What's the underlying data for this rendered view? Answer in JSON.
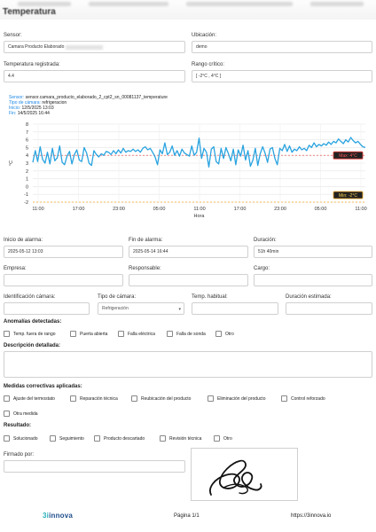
{
  "header": {
    "title": "Temperatura"
  },
  "fields": {
    "sensor": {
      "label": "Sensor:",
      "value": "Camara Producto Elaborado"
    },
    "ubicacion": {
      "label": "Ubicación:",
      "value": "demo"
    },
    "temp_registrada": {
      "label": "Temperatura registrada:",
      "value": "4.4"
    },
    "rango": {
      "label": "Rango crítico:",
      "value": "[ -2°C , 4°C ]"
    }
  },
  "chart_info": {
    "sensor_key": "Sensor:",
    "sensor_val": "sensor.camara_producto_elaborado_2_cpt2_sn_00081137_temperature",
    "tipo_key": "Tipo de cámara:",
    "tipo_val": "refrigeracion",
    "inicio_key": "Inicio:",
    "inicio_val": "12/5/2025 13:03",
    "fin_key": "Fin:",
    "fin_val": "14/5/2025 16:44"
  },
  "chart_data": {
    "type": "line",
    "ylabel": "°C",
    "xlabel": "Hora",
    "ylim": [
      -2,
      8
    ],
    "yticks": [
      -2,
      -1,
      0,
      1,
      2,
      3,
      4,
      5,
      6,
      7,
      8
    ],
    "xticks": [
      "11:00",
      "17:00",
      "23:00",
      "05:00",
      "11:00",
      "17:00",
      "23:00",
      "05:00",
      "11:00"
    ],
    "series": [
      {
        "values": [
          3.1,
          4.6,
          3.2,
          5.1,
          3.5,
          3.0,
          4.4,
          2.9,
          4.9,
          3.3,
          3.7,
          5.2,
          3.1,
          2.8,
          3.9,
          4.5,
          2.9,
          4.1,
          4.7,
          3.4,
          3.2,
          5.0,
          4.3,
          3.0,
          2.7,
          4.6,
          4.1,
          3.8,
          4.2,
          4.0,
          4.5,
          4.4,
          4.1,
          4.6,
          4.2,
          4.7,
          4.3,
          4.9,
          4.4,
          4.6,
          4.5,
          4.8,
          4.5,
          4.7,
          4.4,
          4.9,
          5.1,
          4.7,
          4.9,
          4.4,
          3.8,
          2.8,
          4.7,
          4.2,
          5.6,
          4.1,
          4.4,
          5.2,
          4.0,
          4.6,
          3.9,
          4.8,
          4.3,
          4.1,
          3.9,
          5.2,
          4.0,
          4.4,
          6.2,
          3.6,
          4.9,
          4.4,
          2.5,
          4.8,
          5.1,
          3.2,
          2.9,
          4.9,
          3.6,
          5.0,
          4.2,
          3.3,
          4.8,
          2.8,
          4.7,
          3.9,
          5.3,
          3.4,
          4.6,
          2.6,
          3.4,
          4.9,
          2.7,
          4.2,
          5.1,
          4.3,
          3.1,
          4.8,
          5.0,
          3.6,
          2.8,
          4.9,
          4.6,
          5.4,
          4.5,
          5.2,
          4.4,
          4.8,
          4.6,
          5.1,
          4.7,
          4.9,
          4.6,
          5.3,
          5.0,
          5.6,
          5.1,
          5.4,
          5.2,
          5.5,
          5.3,
          5.7,
          5.4,
          5.8,
          5.6,
          6.1,
          5.8,
          5.5,
          6.0,
          5.7,
          6.3,
          5.9,
          5.6,
          5.8,
          5.4,
          5.1,
          5.0
        ]
      }
    ],
    "threshold_lines": [
      {
        "label": "Max: 4°C",
        "value": 4,
        "color": "#e53935"
      },
      {
        "label": "Min: -2°C",
        "value": -2,
        "color": "#f9a825"
      }
    ]
  },
  "alarm": {
    "inicio": {
      "label": "Inicio de alarma:",
      "value": "2025-05-12 13:03"
    },
    "fin": {
      "label": "Fin de alarma:",
      "value": "2025-05-14 16:44"
    },
    "duracion": {
      "label": "Duración:",
      "value": "51h 40min"
    }
  },
  "people": {
    "empresa": {
      "label": "Empresa:"
    },
    "responsable": {
      "label": "Responsable:"
    },
    "cargo": {
      "label": "Cargo:"
    }
  },
  "camera": {
    "id": {
      "label": "Identificación cámara:"
    },
    "tipo": {
      "label": "Tipo de cámara:",
      "value": "Refrigeración"
    },
    "temp_habitual": {
      "label": "Temp. habitual:"
    },
    "duracion_est": {
      "label": "Duración estimada:"
    }
  },
  "anomalias": {
    "title": "Anomalías detectadas:",
    "options": [
      "Temp. fuera de rango",
      "Puerta abierta",
      "Falla eléctrica",
      "Falla de sonda",
      "Otro"
    ]
  },
  "descripcion": {
    "title": "Descripción detallada:"
  },
  "medidas": {
    "title": "Medidas correctivas aplicadas:",
    "options": [
      "Ajuste del termostato",
      "Reparación técnica",
      "Reubicación del producto",
      "Eliminación del producto",
      "Control reforzado",
      "Otra medida"
    ]
  },
  "resultado": {
    "title": "Resultado:",
    "options": [
      "Solucionado",
      "Seguimiento",
      "Producto descartado",
      "Revisión técnica",
      "Otro"
    ]
  },
  "firma": {
    "label": "Firmado por:"
  },
  "footer": {
    "logo_a": "3i",
    "logo_b": "innova",
    "page": "Página 1/1",
    "url": "https://3innova.io"
  }
}
